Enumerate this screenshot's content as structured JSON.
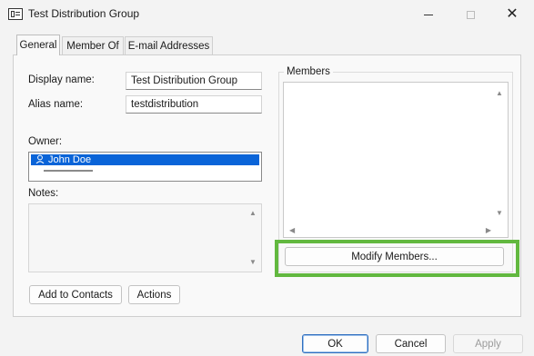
{
  "window": {
    "title": "Test Distribution Group",
    "icons": {
      "app": "address-card-icon",
      "minimize": "minimize-icon",
      "maximize": "maximize-icon",
      "close": "close-icon",
      "close_glyph": "✕"
    }
  },
  "tabs": [
    {
      "label": "General",
      "active": true
    },
    {
      "label": "Member Of",
      "active": false
    },
    {
      "label": "E-mail Addresses",
      "active": false
    }
  ],
  "general": {
    "display_name_label": "Display name:",
    "display_name_value": "Test Distribution Group",
    "alias_label": "Alias name:",
    "alias_value": "testdistribution",
    "owner_label": "Owner:",
    "owner_value": "John Doe",
    "owner_icon": "person-icon",
    "notes_label": "Notes:",
    "add_to_contacts": "Add to Contacts",
    "actions": "Actions"
  },
  "members": {
    "group_label": "Members",
    "modify_button": "Modify Members...",
    "highlight_color": "#62b83f"
  },
  "footer": {
    "ok": "OK",
    "cancel": "Cancel",
    "apply": "Apply"
  },
  "colors": {
    "selection": "#0a64d8",
    "dialog_bg": "#f3f3f3",
    "ok_border": "#2f6fbf"
  }
}
